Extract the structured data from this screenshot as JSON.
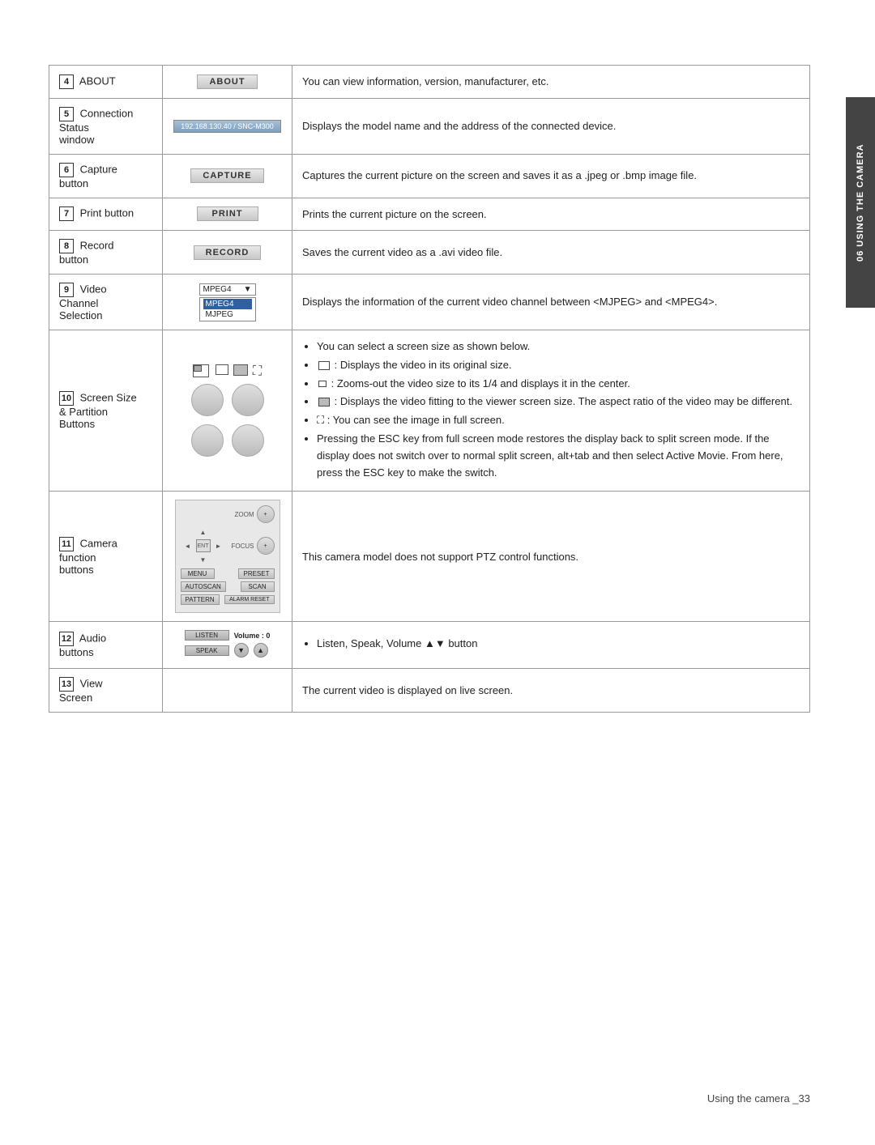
{
  "side_tab": {
    "label": "06  USING THE CAMERA"
  },
  "footer": {
    "text": "Using the camera _33"
  },
  "rows": [
    {
      "num": "4",
      "label": "ABOUT",
      "ui_type": "about_btn",
      "description": "You can view information, version, manufacturer, etc."
    },
    {
      "num": "5",
      "label": "Connection\nStatus\nwindow",
      "ui_type": "connection_bar",
      "ui_value": "192.168.130.40 / SNC-M300",
      "description": "Displays the model name and the address of the connected device."
    },
    {
      "num": "6",
      "label": "Capture\nbutton",
      "ui_type": "capture_btn",
      "description": "Captures the current picture on the screen and saves it as a .jpeg or .bmp image file."
    },
    {
      "num": "7",
      "label": "Print button",
      "ui_type": "print_btn",
      "description": "Prints the current picture on the screen."
    },
    {
      "num": "8",
      "label": "Record\nbutton",
      "ui_type": "record_btn",
      "description": "Saves the current video as a .avi video file."
    },
    {
      "num": "9",
      "label": "Video\nChannel\nSelection",
      "ui_type": "video_select",
      "description": "Displays the information of the current video channel between <MJPEG> and <MPEG4>."
    },
    {
      "num": "10",
      "label": "Screen Size\n& Partition\nButtons",
      "ui_type": "screen_size",
      "bullets": [
        "You can select a screen size as shown below.",
        ": Displays the video in its original size.",
        ": Zooms-out the video size to its 1/4 and displays it in the center.",
        ": Displays the video fitting to the viewer screen size. The aspect ratio of the video may be different.",
        ": You can see the image in full screen.",
        "Pressing the ESC key from full screen mode restores the display back to split screen mode. If the display does not switch over to normal split screen, alt+tab and then select Active Movie. From here, press the ESC key to make the switch."
      ]
    },
    {
      "num": "11",
      "label": "Camera\nfunction\nbuttons",
      "ui_type": "camera_btns",
      "description": "This camera model does not support PTZ control functions."
    },
    {
      "num": "12",
      "label": "Audio\nbuttons",
      "ui_type": "audio_btns",
      "bullets": [
        "Listen, Speak, Volume ▲▼ button"
      ]
    },
    {
      "num": "13",
      "label": "View\nScreen",
      "ui_type": "none",
      "description": "The current video is displayed on live screen."
    }
  ]
}
